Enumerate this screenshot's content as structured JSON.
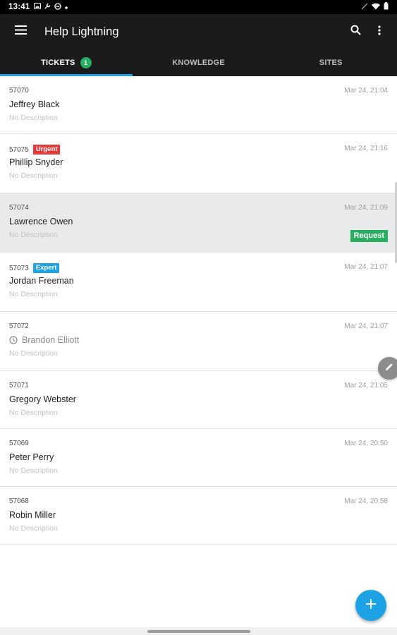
{
  "status_bar": {
    "time": "13:41"
  },
  "app_bar": {
    "title": "Help Lightning"
  },
  "tabs": [
    {
      "label": "TICKETS",
      "count": "1"
    },
    {
      "label": "KNOWLEDGE"
    },
    {
      "label": "SITES"
    }
  ],
  "tickets": [
    {
      "id": "57070",
      "date": "Mar 24, 21:04",
      "name": "Jeffrey Black",
      "description": "No Description"
    },
    {
      "id": "57075",
      "tag": "Urgent",
      "date": "Mar 24, 21:16",
      "name": "Phillip Snyder",
      "description": "No Description"
    },
    {
      "id": "57074",
      "date": "Mar 24, 21:09",
      "name": "Lawrence Owen",
      "description": "No Description",
      "status": "Request"
    },
    {
      "id": "57073",
      "tag": "Expert",
      "date": "Mar 24, 21:07",
      "name": "Jordan Freeman",
      "description": "No Description"
    },
    {
      "id": "57072",
      "date": "Mar 24, 21:07",
      "name": "Brandon Elliott",
      "description": "No Description"
    },
    {
      "id": "57071",
      "date": "Mar 24, 21:05",
      "name": "Gregory Webster",
      "description": "No Description"
    },
    {
      "id": "57069",
      "date": "Mar 24, 20:50",
      "name": "Peter Perry",
      "description": "No Description"
    },
    {
      "id": "57068",
      "date": "Mar 24, 20:58",
      "name": "Robin Miller",
      "description": "No Description"
    }
  ],
  "colors": {
    "accent": "#1ea2e6",
    "urgent": "#e53935",
    "expert": "#1ea2e6",
    "request": "#27ae60",
    "tab_count": "#27ae60"
  },
  "icons": [
    "menu-icon",
    "search-icon",
    "more-vert-icon",
    "clock-icon",
    "pencil-icon",
    "plus-icon"
  ]
}
